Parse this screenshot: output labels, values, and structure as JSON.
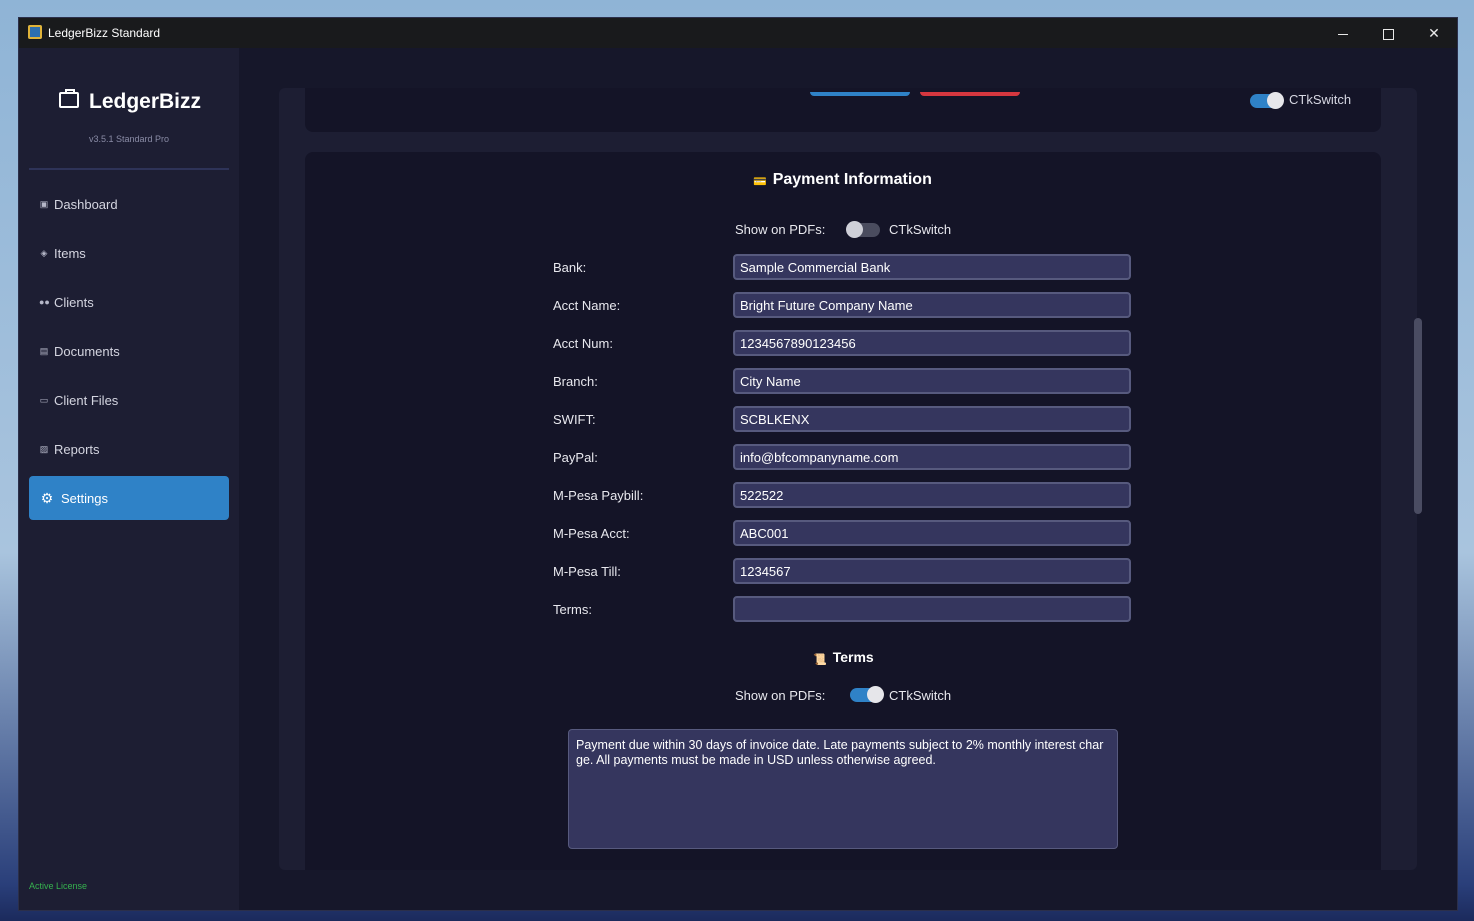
{
  "window": {
    "title": "LedgerBizz Standard"
  },
  "sidebar": {
    "brand": "LedgerBizz",
    "version": "v3.5.1 Standard Pro",
    "items": [
      {
        "label": "Dashboard",
        "icon": "dashboard-icon"
      },
      {
        "label": "Items",
        "icon": "items-icon"
      },
      {
        "label": "Clients",
        "icon": "clients-icon"
      },
      {
        "label": "Documents",
        "icon": "documents-icon"
      },
      {
        "label": "Client Files",
        "icon": "folder-icon"
      },
      {
        "label": "Reports",
        "icon": "reports-icon"
      },
      {
        "label": "Settings",
        "icon": "gear-icon",
        "active": true
      }
    ],
    "license": "Active License"
  },
  "top_card": {
    "switch_label": "CTkSwitch",
    "switch_on": true
  },
  "payment": {
    "title": "Payment Information",
    "show_on_pdfs_label": "Show on PDFs:",
    "switch_label": "CTkSwitch",
    "switch_on": false,
    "fields": [
      {
        "label": "Bank:",
        "value": "Sample Commercial Bank"
      },
      {
        "label": "Acct Name:",
        "value": "Bright Future Company Name"
      },
      {
        "label": "Acct Num:",
        "value": "1234567890123456"
      },
      {
        "label": "Branch:",
        "value": "City Name"
      },
      {
        "label": "SWIFT:",
        "value": "SCBLKENX"
      },
      {
        "label": "PayPal:",
        "value": "info@bfcompanyname.com"
      },
      {
        "label": "M-Pesa Paybill:",
        "value": "522522"
      },
      {
        "label": "M-Pesa Acct:",
        "value": "ABC001"
      },
      {
        "label": "M-Pesa Till:",
        "value": "1234567"
      },
      {
        "label": "Terms:",
        "value": ""
      }
    ]
  },
  "terms": {
    "title": "Terms",
    "show_on_pdfs_label": "Show on PDFs:",
    "switch_label": "CTkSwitch",
    "switch_on": true,
    "text": "Payment due within 30 days of invoice date. Late payments subject to 2% monthly interest charge. All payments must be made in USD unless otherwise agreed."
  },
  "colors": {
    "accent": "#2f82c7",
    "danger": "#d6373f",
    "license": "#36b24f",
    "field_bg": "#35365e"
  }
}
